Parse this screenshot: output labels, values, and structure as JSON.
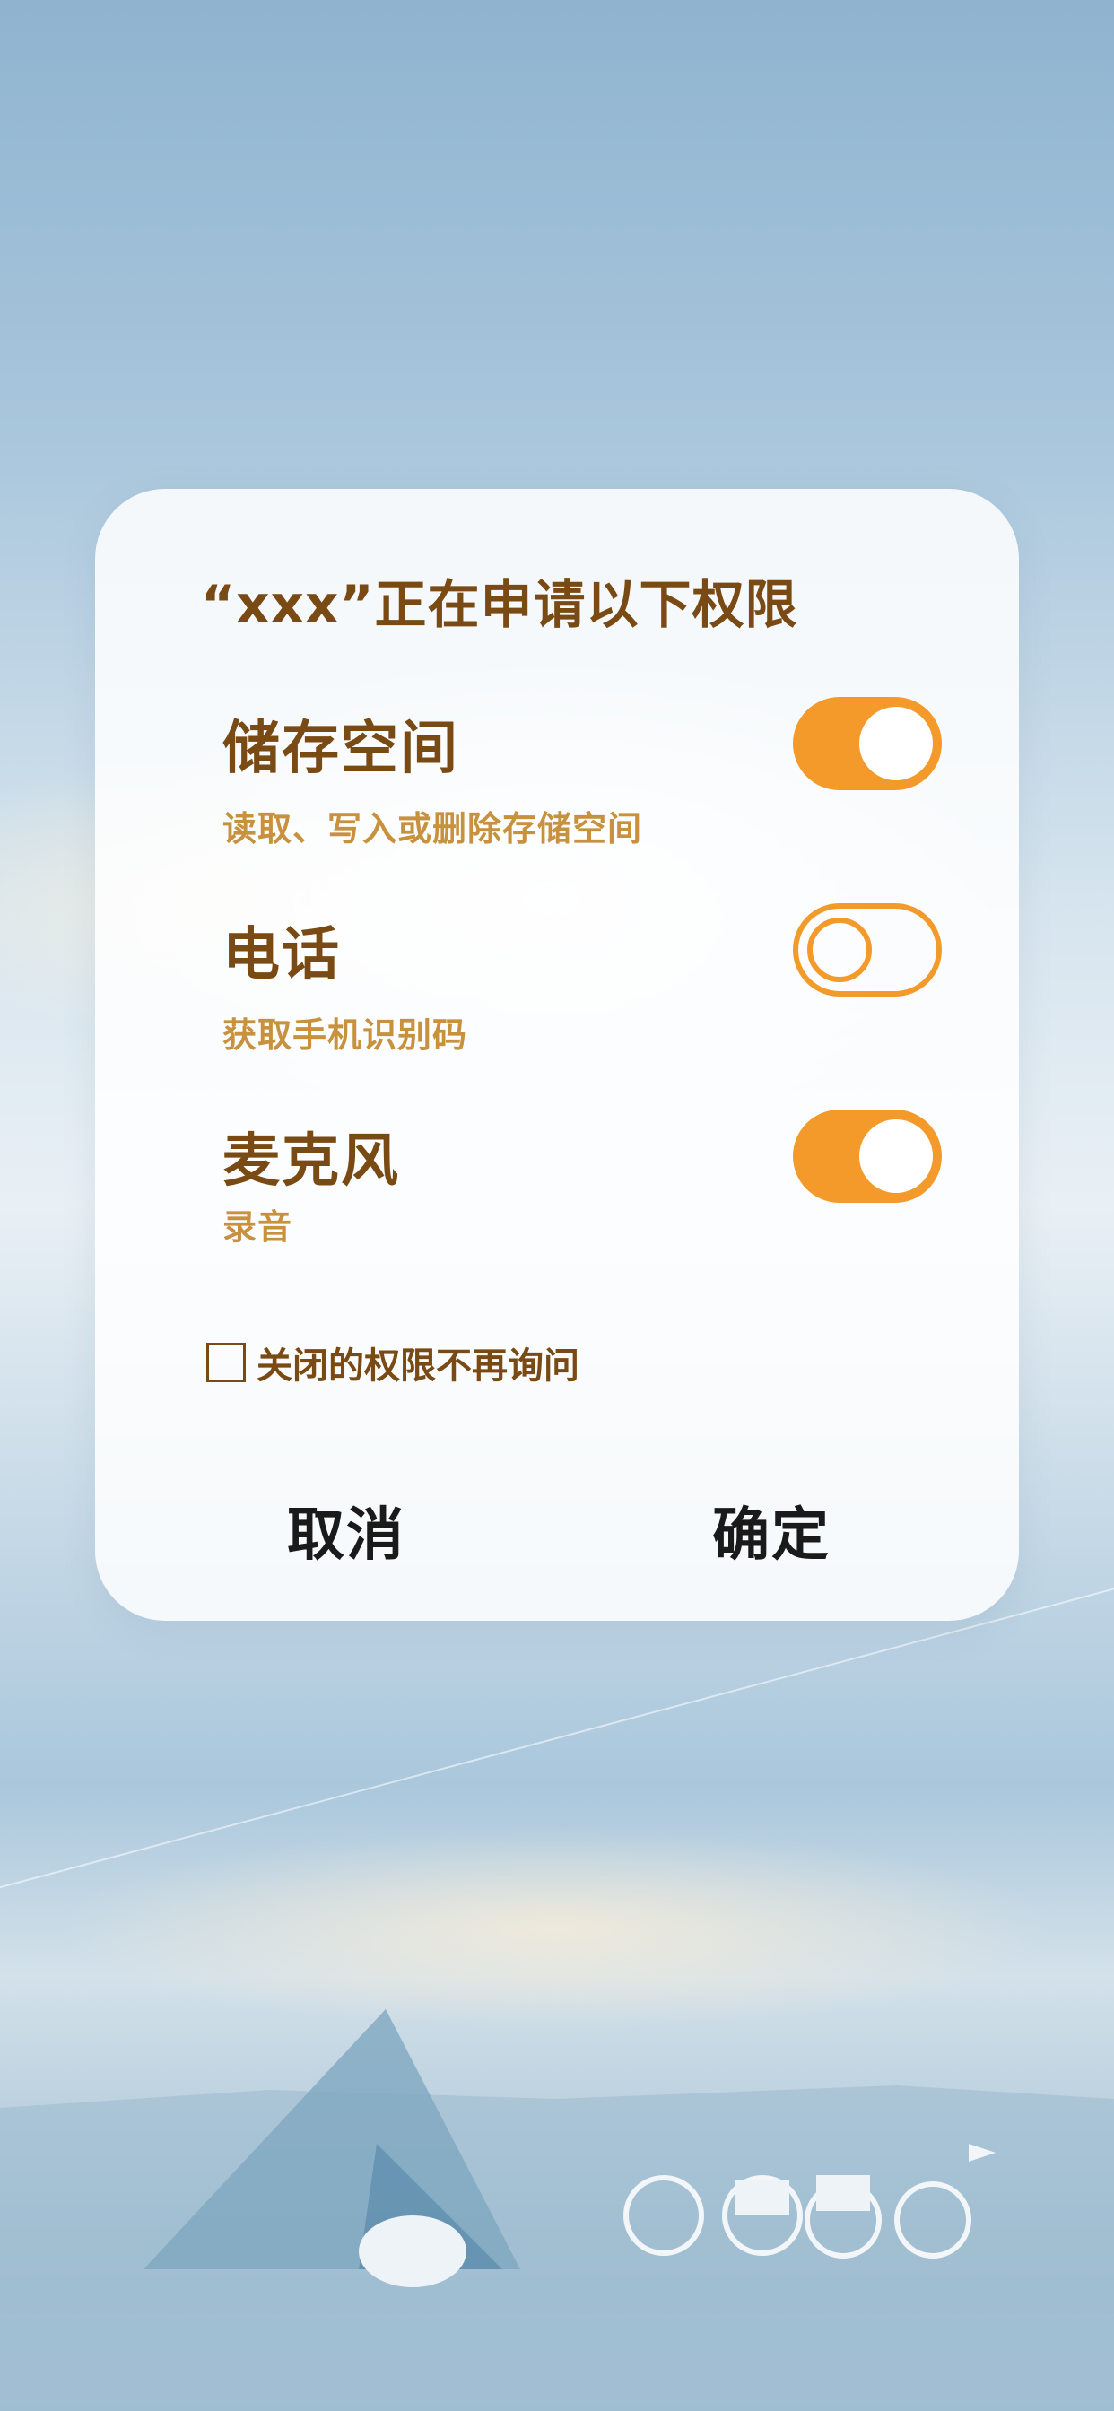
{
  "dialog": {
    "title": "“xxx”正在申请以下权限",
    "permissions": [
      {
        "name": "储存空间",
        "desc": "读取、写入或删除存储空间",
        "enabled": true
      },
      {
        "name": "电话",
        "desc": "获取手机识别码",
        "enabled": false
      },
      {
        "name": "麦克风",
        "desc": "录音",
        "enabled": true
      }
    ],
    "dont_ask_label": "关闭的权限不再询问",
    "dont_ask_checked": false,
    "cancel_label": "取消",
    "confirm_label": "确定"
  },
  "colors": {
    "accent": "#f39a2b",
    "title_text": "#7a4a15",
    "desc_text": "#c8913e"
  }
}
